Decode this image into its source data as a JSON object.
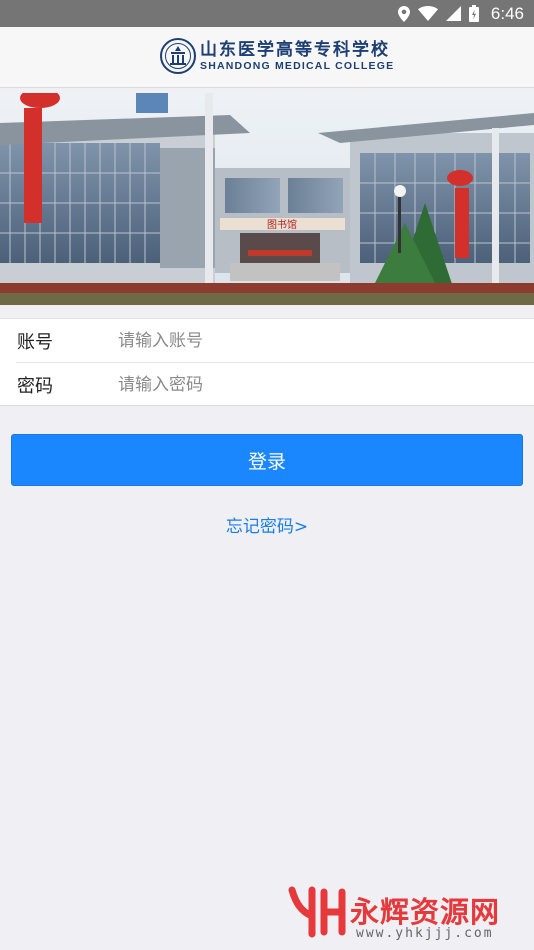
{
  "status_bar": {
    "time": "6:46",
    "icons": [
      "location-icon",
      "wifi-icon",
      "signal-icon",
      "battery-icon"
    ]
  },
  "header": {
    "school_name_cn": "山东医学高等专科学校",
    "school_name_en": "SHANDONG MEDICAL COLLEGE",
    "logo_icon": "school-emblem-icon"
  },
  "banner": {
    "building_sign": "图书馆",
    "image": "campus-library-photo"
  },
  "form": {
    "account": {
      "label": "账号",
      "placeholder": "请输入账号",
      "value": ""
    },
    "password": {
      "label": "密码",
      "placeholder": "请输入密码",
      "value": ""
    }
  },
  "actions": {
    "login_label": "登录",
    "forgot_label": "忘记密码>"
  },
  "watermark": {
    "text": "永辉资源网",
    "url": "www.yhkjjj.com"
  },
  "colors": {
    "primary": "#1a86ff",
    "link": "#1a7ee8",
    "background": "#efeff4",
    "status_bar": "#757575",
    "brand_navy": "#1e3f73"
  }
}
